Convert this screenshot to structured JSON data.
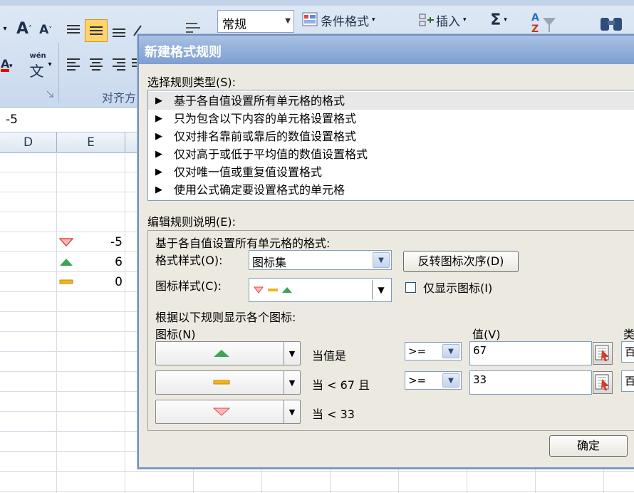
{
  "ribbon": {
    "font_grow": "A",
    "font_shrink": "A",
    "phonetic": "wén",
    "phonetic_char": "文",
    "number_format": "常规",
    "conditional_format": "条件格式",
    "insert": "插入",
    "sum_symbol": "Σ",
    "alignment_group": "对齐方"
  },
  "formula_bar": {
    "value": "-5"
  },
  "grid": {
    "columns": [
      "D",
      "E"
    ],
    "cells": [
      {
        "icon": "red-down",
        "value": "-5"
      },
      {
        "icon": "green-up",
        "value": "6"
      },
      {
        "icon": "yellow-flat",
        "value": "0"
      }
    ]
  },
  "dialog": {
    "title": "新建格式规则",
    "select_rule_type_label": "选择规则类型(S):",
    "rule_types": [
      "基于各自值设置所有单元格的格式",
      "只为包含以下内容的单元格设置格式",
      "仅对排名靠前或靠后的数值设置格式",
      "仅对高于或低于平均值的数值设置格式",
      "仅对唯一值或重复值设置格式",
      "使用公式确定要设置格式的单元格"
    ],
    "edit_rule_label": "编辑规则说明(E):",
    "desc_heading": "基于各自值设置所有单元格的格式:",
    "format_style_label": "格式样式(O):",
    "format_style_value": "图标集",
    "reverse_icon_order": "反转图标次序(D)",
    "icon_style_label": "图标样式(C):",
    "show_icon_only": "仅显示图标(I)",
    "rules_heading": "根据以下规则显示各个图标:",
    "icon_col_label": "图标(N)",
    "value_col_label": "值(V)",
    "type_col_label": "类",
    "rows": [
      {
        "condition": "当值是",
        "operator": ">=",
        "value": "67",
        "type": "百"
      },
      {
        "condition": "当 < 67 且",
        "operator": ">=",
        "value": "33",
        "type": "百"
      },
      {
        "condition": "当 < 33"
      }
    ],
    "ok_button": "确定"
  },
  "colors": {
    "icon_green": "#3aa655",
    "icon_yellow": "#f2b41b",
    "icon_red": "#e0474c",
    "dialog_title_bg": "#7d9fd1"
  }
}
